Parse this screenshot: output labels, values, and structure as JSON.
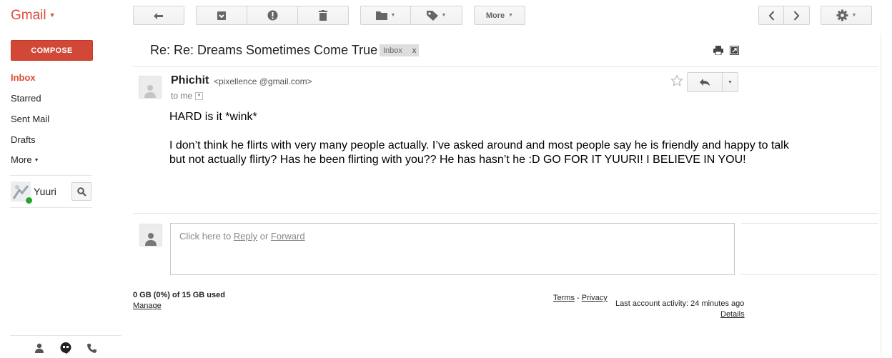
{
  "app": {
    "logo_text": "Gmail"
  },
  "toolbar": {
    "back_icon": "back-arrow-icon",
    "archive_icon": "archive-icon",
    "spam_icon": "report-spam-icon",
    "delete_icon": "trash-icon",
    "move_icon": "folder-icon",
    "labels_icon": "tag-icon",
    "more_label": "More"
  },
  "sidebar": {
    "compose_label": "COMPOSE",
    "items": [
      {
        "label": "Inbox",
        "active": true
      },
      {
        "label": "Starred"
      },
      {
        "label": "Sent Mail"
      },
      {
        "label": "Drafts"
      },
      {
        "label": "More"
      }
    ],
    "chat_user": {
      "name": "Yuuri",
      "status": "online"
    },
    "accent": "#dd4b39"
  },
  "thread": {
    "subject": "Re: Re: Dreams Sometimes Come True",
    "label_chip": "Inbox",
    "label_remove": "x",
    "message": {
      "sender_name": "Phichit",
      "sender_email": "<pixellence @gmail.com>",
      "to_line": "to me",
      "body_lines": [
        "HARD is it *wink*",
        "I don’t think he flirts with very many people actually.  I’ve asked around and most people say he is friendly and happy to talk",
        "but not actually flirty? Has he been flirting with you?? He has hasn’t he :D GO FOR IT YUURI! I BELIEVE IN YOU!"
      ]
    },
    "reply_prompt": {
      "prefix": "Click here to ",
      "reply": "Reply",
      "or": " or ",
      "forward": "Forward"
    }
  },
  "footer": {
    "storage": "0 GB (0%) of 15 GB used",
    "manage": "Manage",
    "terms": "Terms",
    "dash": " - ",
    "privacy": "Privacy",
    "activity": "Last account activity: 24 minutes ago",
    "details": "Details"
  }
}
